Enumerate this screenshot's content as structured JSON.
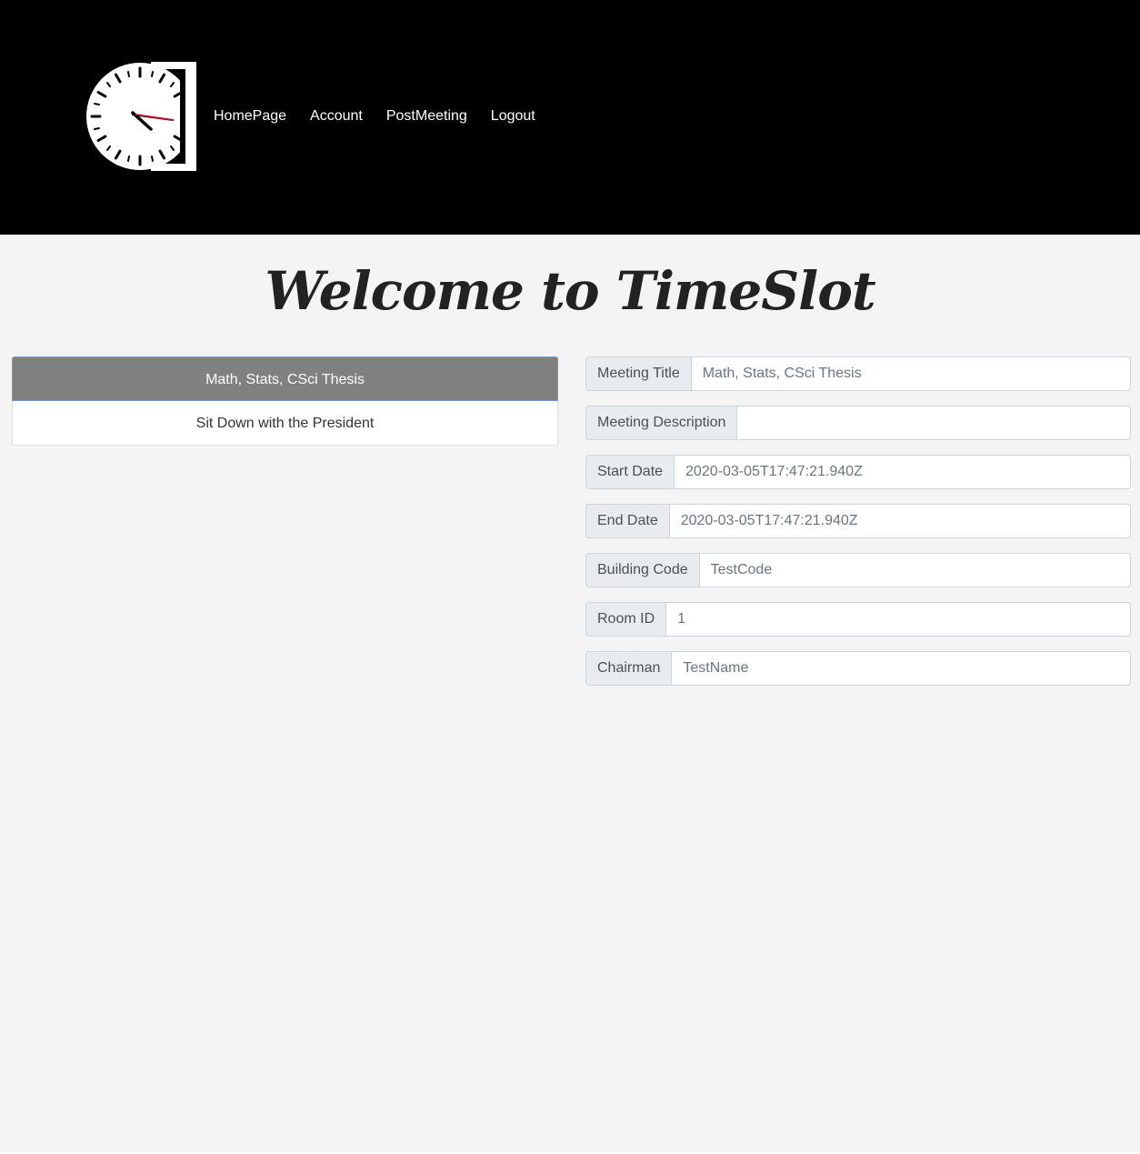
{
  "nav": {
    "logo_icon": "clock-logo-icon",
    "links": [
      "HomePage",
      "Account",
      "PostMeeting",
      "Logout"
    ]
  },
  "page": {
    "title": "Welcome to TimeSlot"
  },
  "meetings": {
    "items": [
      "Math, Stats, CSci Thesis",
      "Sit Down with the President"
    ],
    "selected_index": 0
  },
  "form": {
    "fields": [
      {
        "label": "Meeting Title",
        "placeholder": "Math, Stats, CSci Thesis"
      },
      {
        "label": "Meeting Description",
        "placeholder": ""
      },
      {
        "label": "Start Date",
        "placeholder": "2020-03-05T17:47:21.940Z"
      },
      {
        "label": "End Date",
        "placeholder": "2020-03-05T17:47:21.940Z"
      },
      {
        "label": "Building Code",
        "placeholder": "TestCode"
      },
      {
        "label": "Room ID",
        "placeholder": "1"
      },
      {
        "label": "Chairman",
        "placeholder": "TestName"
      }
    ]
  },
  "colors": {
    "navbar_bg": "#000000",
    "page_bg": "#f4f4f4",
    "active_item_bg": "#808080",
    "clock_second_hand": "#d0021b"
  }
}
